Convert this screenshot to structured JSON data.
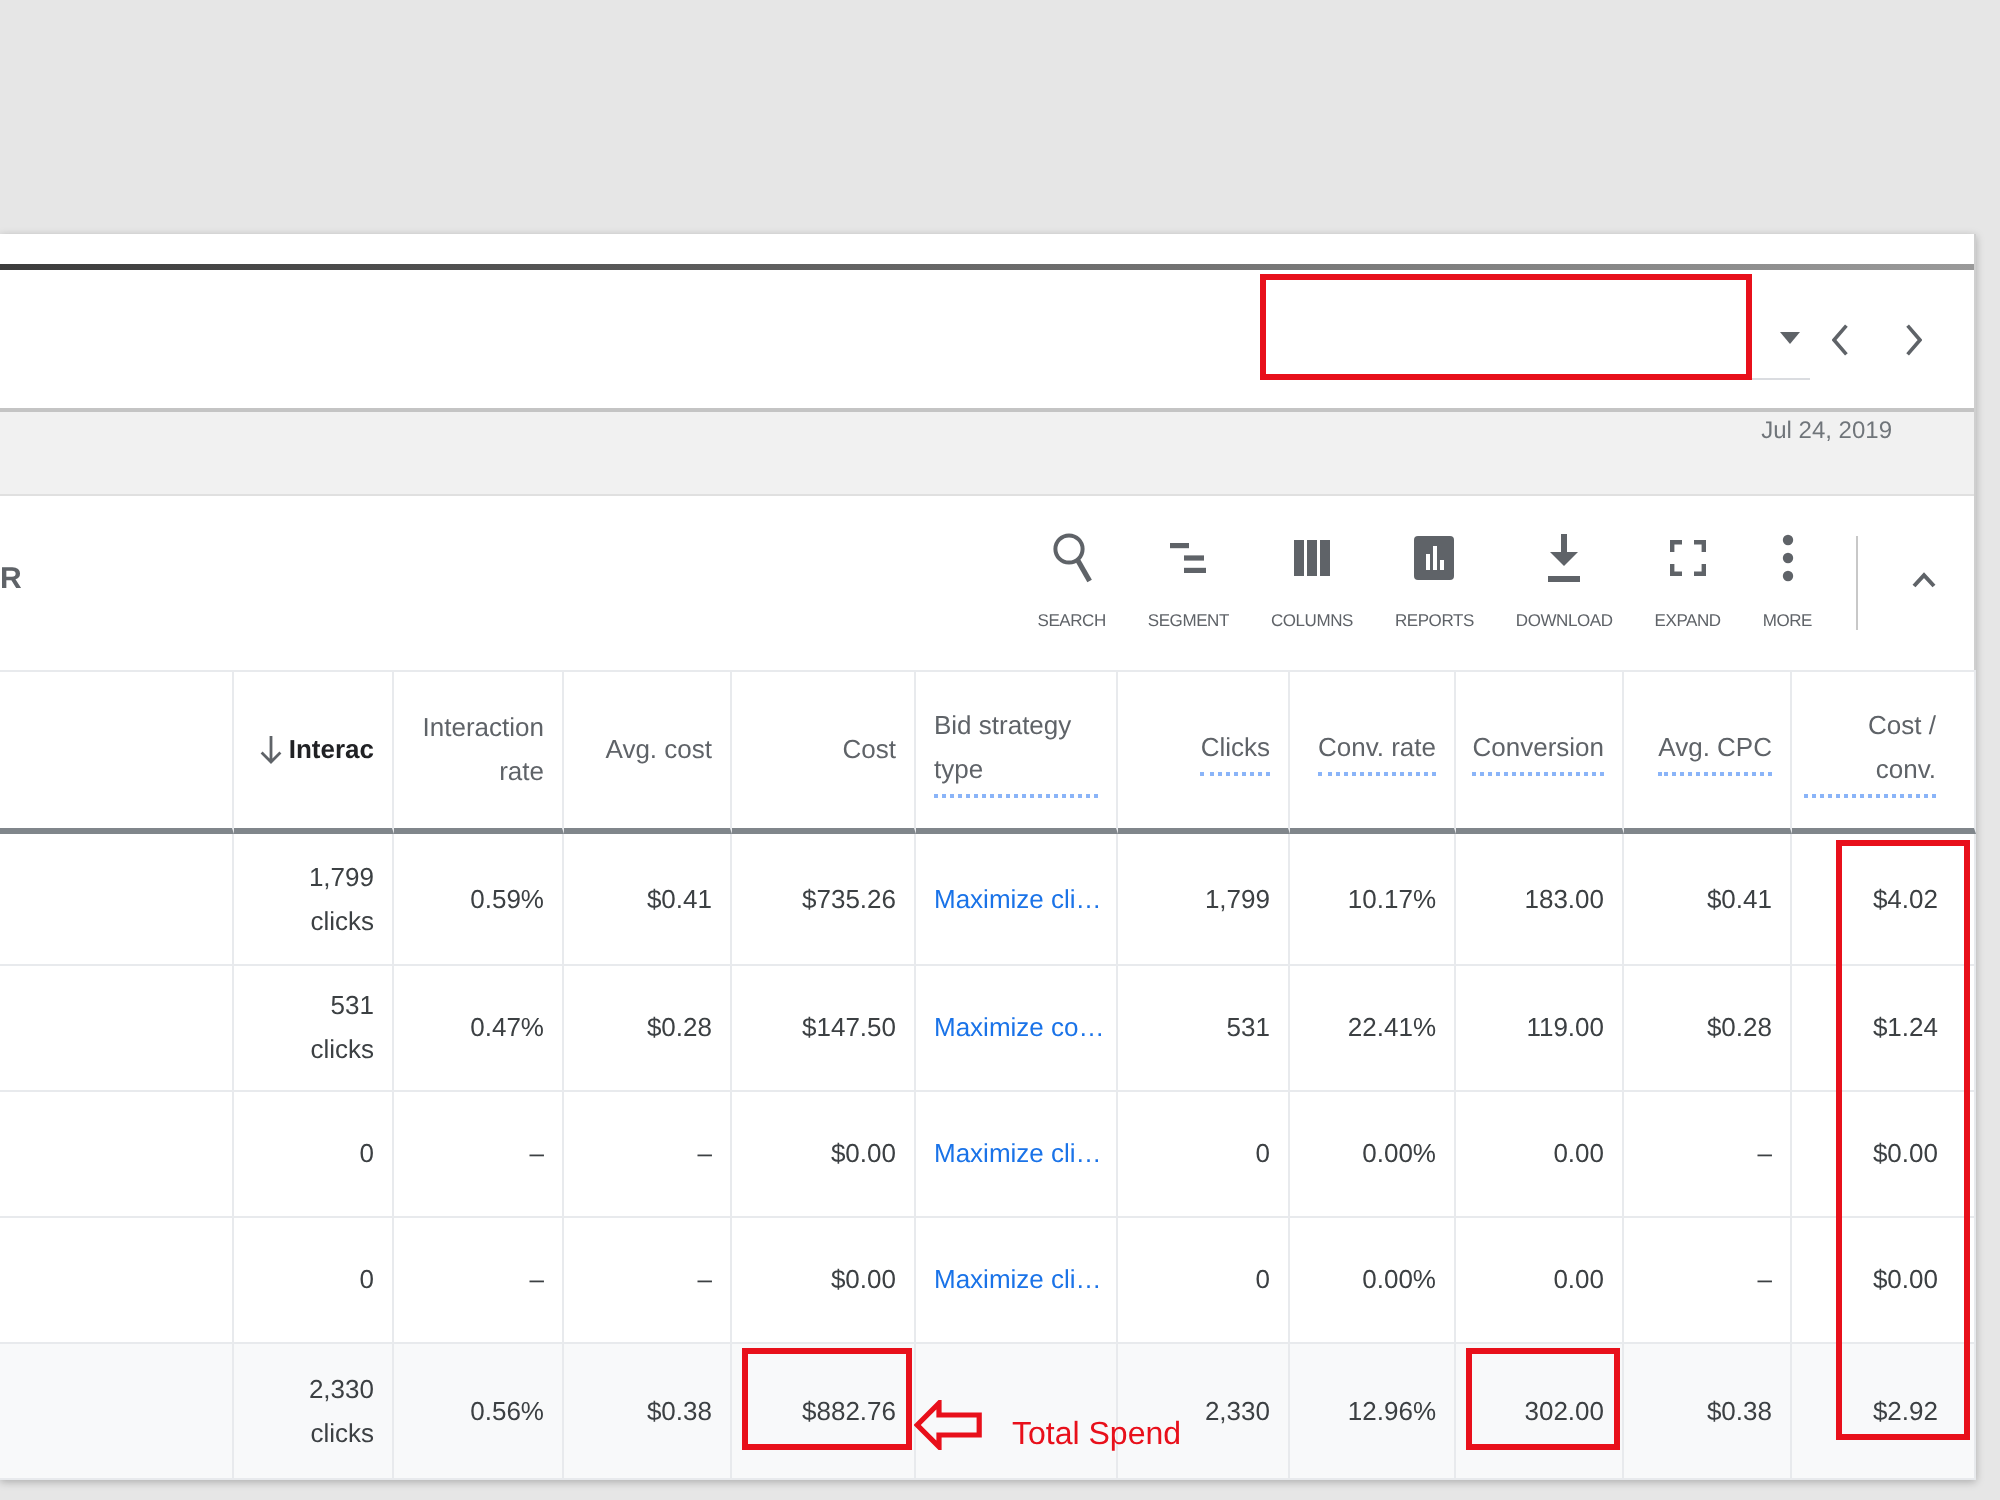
{
  "header": {
    "date_range": {
      "highlighted": true
    }
  },
  "date_label": "Jul 24, 2019",
  "toolbar": {
    "cut_label": "R",
    "buttons": [
      {
        "kind": "search",
        "label": "SEARCH"
      },
      {
        "kind": "segment",
        "label": "SEGMENT"
      },
      {
        "kind": "columns",
        "label": "COLUMNS"
      },
      {
        "kind": "reports",
        "label": "REPORTS"
      },
      {
        "kind": "download",
        "label": "DOWNLOAD"
      },
      {
        "kind": "expand",
        "label": "EXPAND"
      },
      {
        "kind": "more",
        "label": "MORE"
      }
    ]
  },
  "table": {
    "columns": [
      {
        "label": "Interac",
        "sorted": true,
        "dotted_underline": false,
        "highlighted": false
      },
      {
        "label": "Interaction rate",
        "sorted": false,
        "dotted_underline": false,
        "highlighted": false
      },
      {
        "label": "Avg. cost",
        "sorted": false,
        "dotted_underline": false,
        "highlighted": false
      },
      {
        "label": "Cost",
        "sorted": false,
        "dotted_underline": false,
        "highlighted": false
      },
      {
        "label": "Bid strategy type",
        "sorted": false,
        "dotted_underline": true,
        "highlighted": false
      },
      {
        "label": "Clicks",
        "sorted": false,
        "dotted_underline": true,
        "highlighted": false
      },
      {
        "label": "Conv. rate",
        "sorted": false,
        "dotted_underline": true,
        "highlighted": false
      },
      {
        "label": "Conversion",
        "sorted": false,
        "dotted_underline": true,
        "highlighted": false
      },
      {
        "label": "Avg. CPC",
        "sorted": false,
        "dotted_underline": true,
        "highlighted": false
      },
      {
        "label": "Cost / conv.",
        "sorted": false,
        "dotted_underline": true,
        "highlighted": true
      }
    ],
    "rows": [
      {
        "kind": "data",
        "cells": [
          {
            "kind": "count",
            "text": "1,799",
            "unit": "clicks",
            "highlighted": false
          },
          {
            "kind": "number",
            "text": "0.59%",
            "highlighted": false
          },
          {
            "kind": "number",
            "text": "$0.41",
            "highlighted": false
          },
          {
            "kind": "number",
            "text": "$735.26",
            "highlighted": false
          },
          {
            "kind": "link",
            "text": "Maximize cli…",
            "highlighted": false
          },
          {
            "kind": "number",
            "text": "1,799",
            "highlighted": false
          },
          {
            "kind": "number",
            "text": "10.17%",
            "highlighted": false
          },
          {
            "kind": "number",
            "text": "183.00",
            "highlighted": false
          },
          {
            "kind": "number",
            "text": "$0.41",
            "highlighted": false
          },
          {
            "kind": "number",
            "text": "$4.02",
            "highlighted": false
          }
        ]
      },
      {
        "kind": "data",
        "cells": [
          {
            "kind": "count",
            "text": "531",
            "unit": "clicks",
            "highlighted": false
          },
          {
            "kind": "number",
            "text": "0.47%",
            "highlighted": false
          },
          {
            "kind": "number",
            "text": "$0.28",
            "highlighted": false
          },
          {
            "kind": "number",
            "text": "$147.50",
            "highlighted": false
          },
          {
            "kind": "link",
            "text": "Maximize co…",
            "highlighted": false
          },
          {
            "kind": "number",
            "text": "531",
            "highlighted": false
          },
          {
            "kind": "number",
            "text": "22.41%",
            "highlighted": false
          },
          {
            "kind": "number",
            "text": "119.00",
            "highlighted": false
          },
          {
            "kind": "number",
            "text": "$0.28",
            "highlighted": false
          },
          {
            "kind": "number",
            "text": "$1.24",
            "highlighted": false
          }
        ]
      },
      {
        "kind": "data",
        "cells": [
          {
            "kind": "number",
            "text": "0",
            "highlighted": false
          },
          {
            "kind": "number",
            "text": "–",
            "highlighted": false
          },
          {
            "kind": "number",
            "text": "–",
            "highlighted": false
          },
          {
            "kind": "number",
            "text": "$0.00",
            "highlighted": false
          },
          {
            "kind": "link",
            "text": "Maximize cli…",
            "highlighted": false
          },
          {
            "kind": "number",
            "text": "0",
            "highlighted": false
          },
          {
            "kind": "number",
            "text": "0.00%",
            "highlighted": false
          },
          {
            "kind": "number",
            "text": "0.00",
            "highlighted": false
          },
          {
            "kind": "number",
            "text": "–",
            "highlighted": false
          },
          {
            "kind": "number",
            "text": "$0.00",
            "highlighted": false
          }
        ]
      },
      {
        "kind": "data",
        "cells": [
          {
            "kind": "number",
            "text": "0",
            "highlighted": false
          },
          {
            "kind": "number",
            "text": "–",
            "highlighted": false
          },
          {
            "kind": "number",
            "text": "–",
            "highlighted": false
          },
          {
            "kind": "number",
            "text": "$0.00",
            "highlighted": false
          },
          {
            "kind": "link",
            "text": "Maximize cli…",
            "highlighted": false
          },
          {
            "kind": "number",
            "text": "0",
            "highlighted": false
          },
          {
            "kind": "number",
            "text": "0.00%",
            "highlighted": false
          },
          {
            "kind": "number",
            "text": "0.00",
            "highlighted": false
          },
          {
            "kind": "number",
            "text": "–",
            "highlighted": false
          },
          {
            "kind": "number",
            "text": "$0.00",
            "highlighted": false
          }
        ]
      },
      {
        "kind": "total",
        "cells": [
          {
            "kind": "count",
            "text": "2,330",
            "unit": "clicks",
            "highlighted": false
          },
          {
            "kind": "number",
            "text": "0.56%",
            "highlighted": false
          },
          {
            "kind": "number",
            "text": "$0.38",
            "highlighted": false
          },
          {
            "kind": "number",
            "text": "$882.76",
            "highlighted": true
          },
          {
            "kind": "blank",
            "highlighted": false
          },
          {
            "kind": "number",
            "text": "2,330",
            "highlighted": false
          },
          {
            "kind": "number",
            "text": "12.96%",
            "highlighted": false
          },
          {
            "kind": "number",
            "text": "302.00",
            "highlighted": true
          },
          {
            "kind": "number",
            "text": "$0.38",
            "highlighted": false
          },
          {
            "kind": "number",
            "text": "$2.92",
            "highlighted": false
          }
        ]
      }
    ]
  },
  "annotation": {
    "text": "Total Spend"
  }
}
